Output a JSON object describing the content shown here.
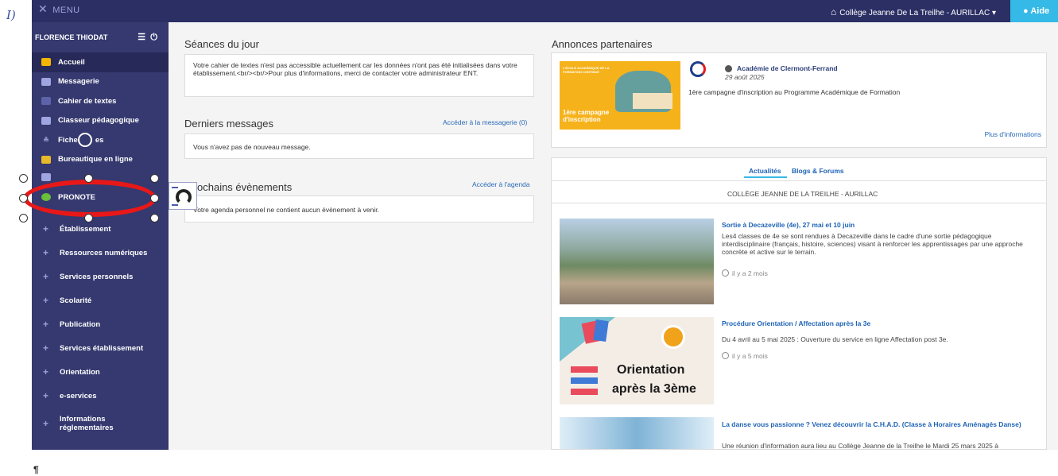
{
  "topbar": {
    "menu_label": "MENU",
    "school": "Collège Jeanne De La Treilhe - AURILLAC",
    "help": "Aide"
  },
  "sidebar": {
    "user": "FLORENCE THIODAT",
    "nav_items": [
      {
        "label": "Accueil",
        "icon": "home-icon"
      },
      {
        "label": "Messagerie",
        "icon": "mail-icon"
      },
      {
        "label": "Cahier de textes",
        "icon": "book-icon"
      },
      {
        "label": "Classeur pédagogique",
        "icon": "folder-icon"
      },
      {
        "label": "Fiche",
        "label_after": "es",
        "icon": "card-icon"
      },
      {
        "label": "Bureautique en ligne",
        "icon": "office-icon"
      },
      {
        "label": "PRONOTE",
        "icon": "pronote-icon"
      }
    ],
    "sections": [
      "Établissement",
      "Ressources numériques",
      "Services personnels",
      "Scolarité",
      "Publication",
      "Services établissement",
      "Orientation",
      "e-services",
      "Informations réglementaires"
    ]
  },
  "seances": {
    "title": "Séances du jour",
    "text": "Votre cahier de textes n'est pas accessible actuellement car les données n'ont pas été initialisées dans votre établissement.<br/><br/>Pour plus d'informations, merci de contacter votre administrateur ENT."
  },
  "messages": {
    "title": "Derniers messages",
    "link": "Accéder à la messagerie (0)",
    "text": "Vous n'avez pas de nouveau message."
  },
  "events": {
    "title": "ochains évènements",
    "link": "Accéder à l'agenda",
    "text": "Votre agenda personnel ne contient aucun évènement à venir."
  },
  "annonces": {
    "title": "Annonces partenaires",
    "org": "Académie de Clermont-Ferrand",
    "date": "29 août 2025",
    "text": "1ère campagne d'inscription au Programme Académique de Formation",
    "more": "Plus d'informations",
    "image_caption": "1ère campagne d'inscription",
    "image_header": "L'ÉCOLE ACADÉMIQUE DE LA FORMATION CONTINUE"
  },
  "news": {
    "tab_active": "Actualités",
    "tab_other": "Blogs & Forums",
    "school_header": "COLLÈGE JEANNE DE LA TREILHE - AURILLAC",
    "items": [
      {
        "title": "Sortie à Decazeville (4e), 27 mai et 10 juin",
        "text": "Les4 classes de 4e se sont rendues à Decazeville dans le cadre d'une sortie pédagogique interdisciplinaire (français, histoire, sciences) visant à renforcer les apprentissages par une approche concrète et active sur le terrain.",
        "ago": "il y a 2 mois"
      },
      {
        "title": "Procédure Orientation / Affectation après la 3e",
        "text": "Du 4 avril au 5 mai 2025 : Ouverture du service en ligne Affectation post 3e.",
        "ago": "il y a 5 mois",
        "image_text_1": "Orientation",
        "image_text_2": "après la 3ème"
      },
      {
        "title": "La danse vous passionne ? Venez découvrir la C.H.A.D. (Classe à Horaires Aménagés Danse)",
        "text": "Une réunion d'information aura lieu au Collège Jeanne de la Treilhe le Mardi 25 mars 2025 à"
      }
    ]
  },
  "colors": {
    "sidebar": "#35396f",
    "topbar": "#2b2f64",
    "accent": "#35b9e6",
    "annotation": "#e81818",
    "link": "#1f63b5"
  },
  "doc_marks": {
    "cursor": "I)",
    "pilcrow": "¶"
  }
}
